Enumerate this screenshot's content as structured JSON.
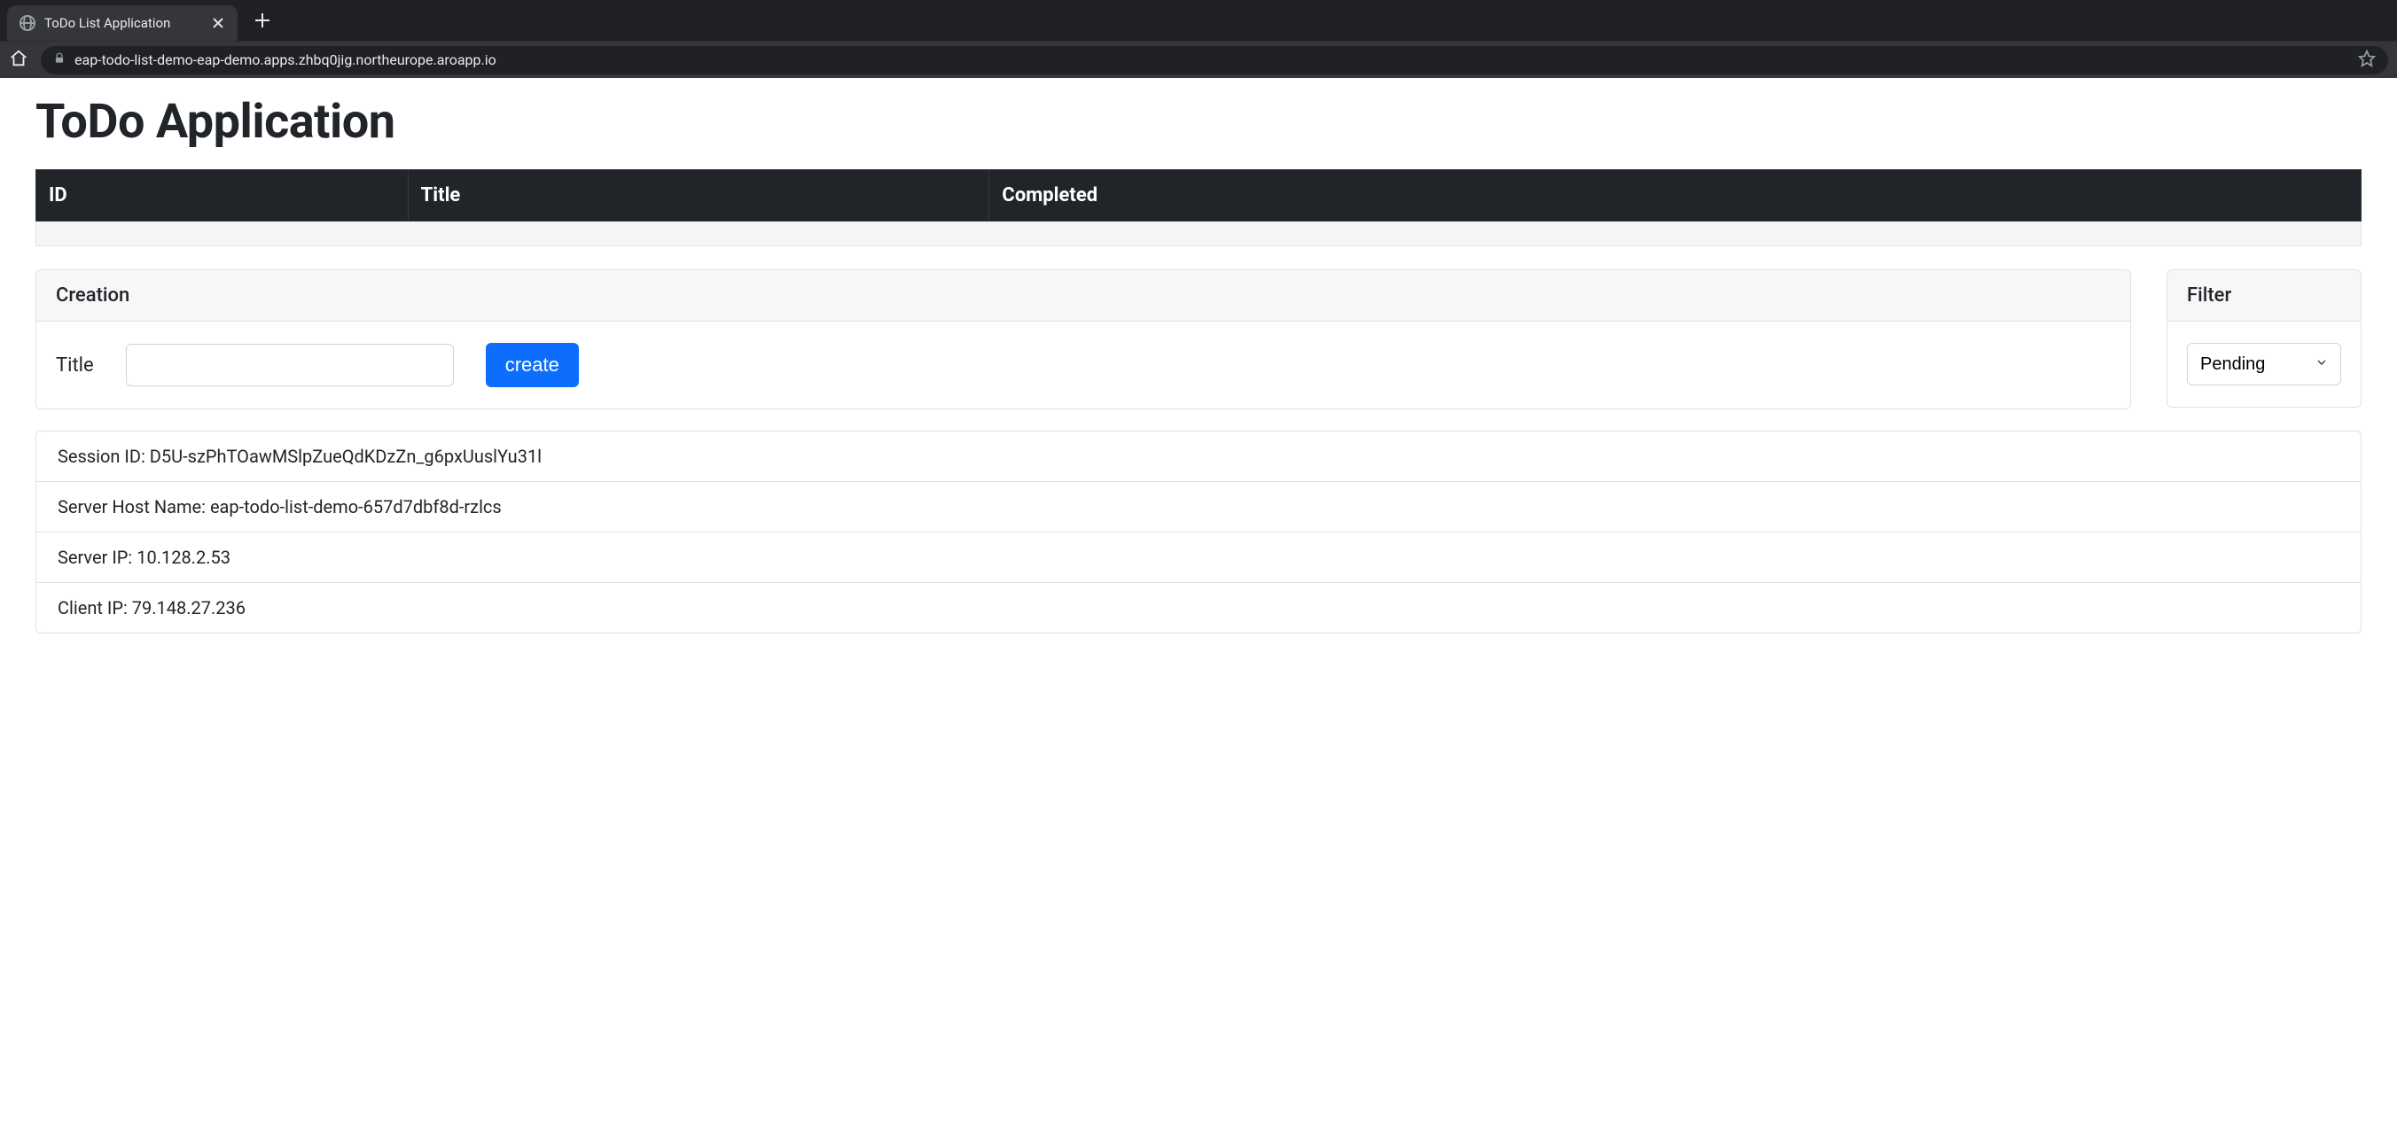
{
  "browser": {
    "tab_title": "ToDo List Application",
    "url": "eap-todo-list-demo-eap-demo.apps.zhbq0jig.northeurope.aroapp.io"
  },
  "page": {
    "title": "ToDo Application"
  },
  "table": {
    "columns": {
      "id": "ID",
      "title": "Title",
      "completed": "Completed"
    }
  },
  "creation": {
    "header": "Creation",
    "title_label": "Title",
    "title_value": "",
    "create_button": "create"
  },
  "filter": {
    "header": "Filter",
    "selected": "Pending"
  },
  "info": {
    "session_label": "Session ID: ",
    "session_value": "D5U-szPhTOawMSlpZueQdKDzZn_g6pxUuslYu31l",
    "server_host_label": "Server Host Name: ",
    "server_host_value": "eap-todo-list-demo-657d7dbf8d-rzlcs",
    "server_ip_label": "Server IP: ",
    "server_ip_value": "10.128.2.53",
    "client_ip_label": "Client IP: ",
    "client_ip_value": "79.148.27.236"
  }
}
